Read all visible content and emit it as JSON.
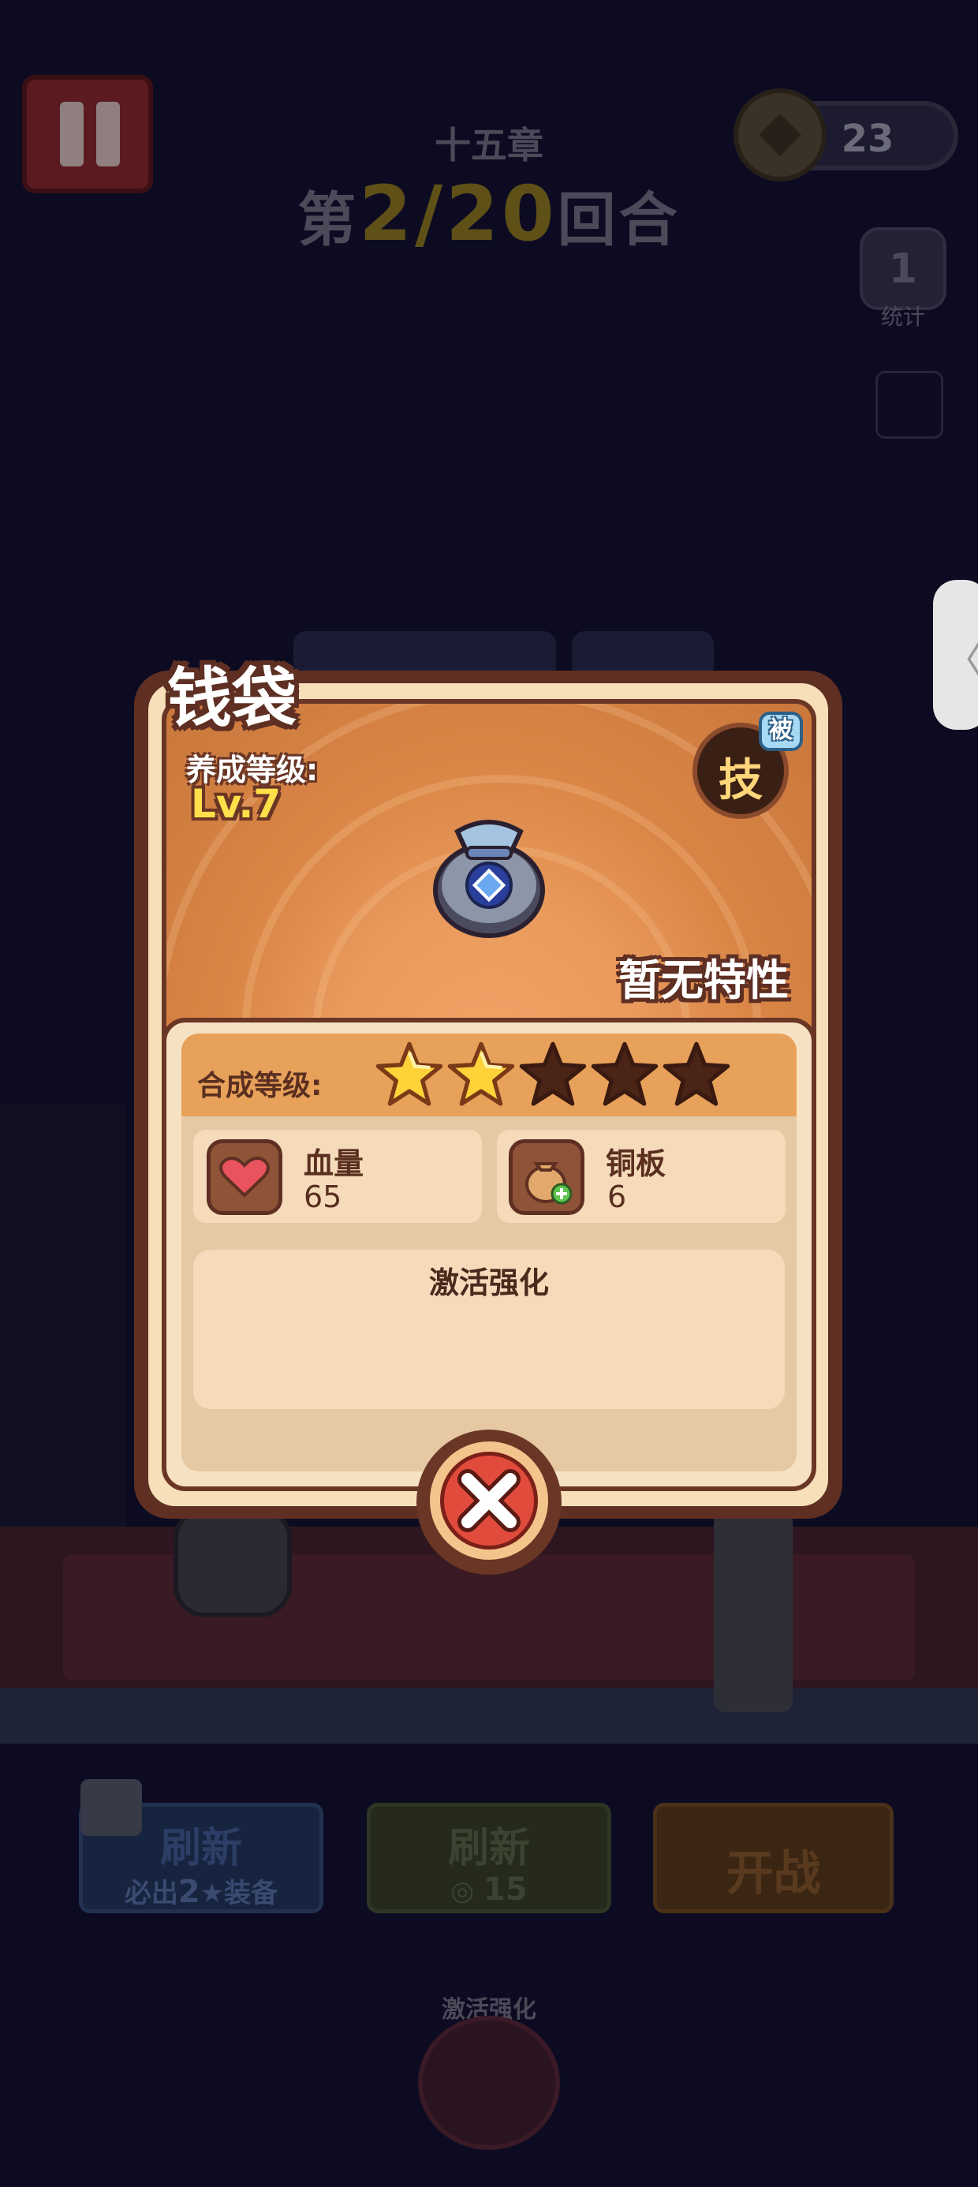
{
  "hud": {
    "chapter": "十五章",
    "round_prefix": "第",
    "round_value": "2/20",
    "round_suffix": "回合",
    "coins": "23",
    "stats_label": "统计"
  },
  "popup": {
    "title": "钱袋",
    "level_label": "养成等级:",
    "level_value": "Lv.7",
    "skill_label": "技",
    "passive_badge": "被",
    "trait_text": "暂无特性",
    "compose_label": "合成等级:",
    "compose_stars": {
      "filled": 2,
      "total": 5
    },
    "stats": [
      {
        "label": "血量",
        "value": "65",
        "icon": "heart-icon"
      },
      {
        "label": "铜板",
        "value": "6",
        "icon": "coin-bag-plus-icon"
      }
    ],
    "enhance_title": "激活强化"
  },
  "bottom": {
    "refresh_ad_label": "刷新",
    "refresh_ad_sub_prefix": "必出",
    "refresh_ad_sub_count": "2",
    "refresh_ad_sub_suffix": "装备",
    "refresh_coin_label": "刷新",
    "refresh_coin_cost": "15",
    "start_label": "开战",
    "enhance_label": "激活强化"
  },
  "colors": {
    "accent_gold": "#ffdf4a",
    "card_border": "#5e2f22",
    "card_orange": "#e99a5c",
    "close_red": "#e14b3c"
  }
}
